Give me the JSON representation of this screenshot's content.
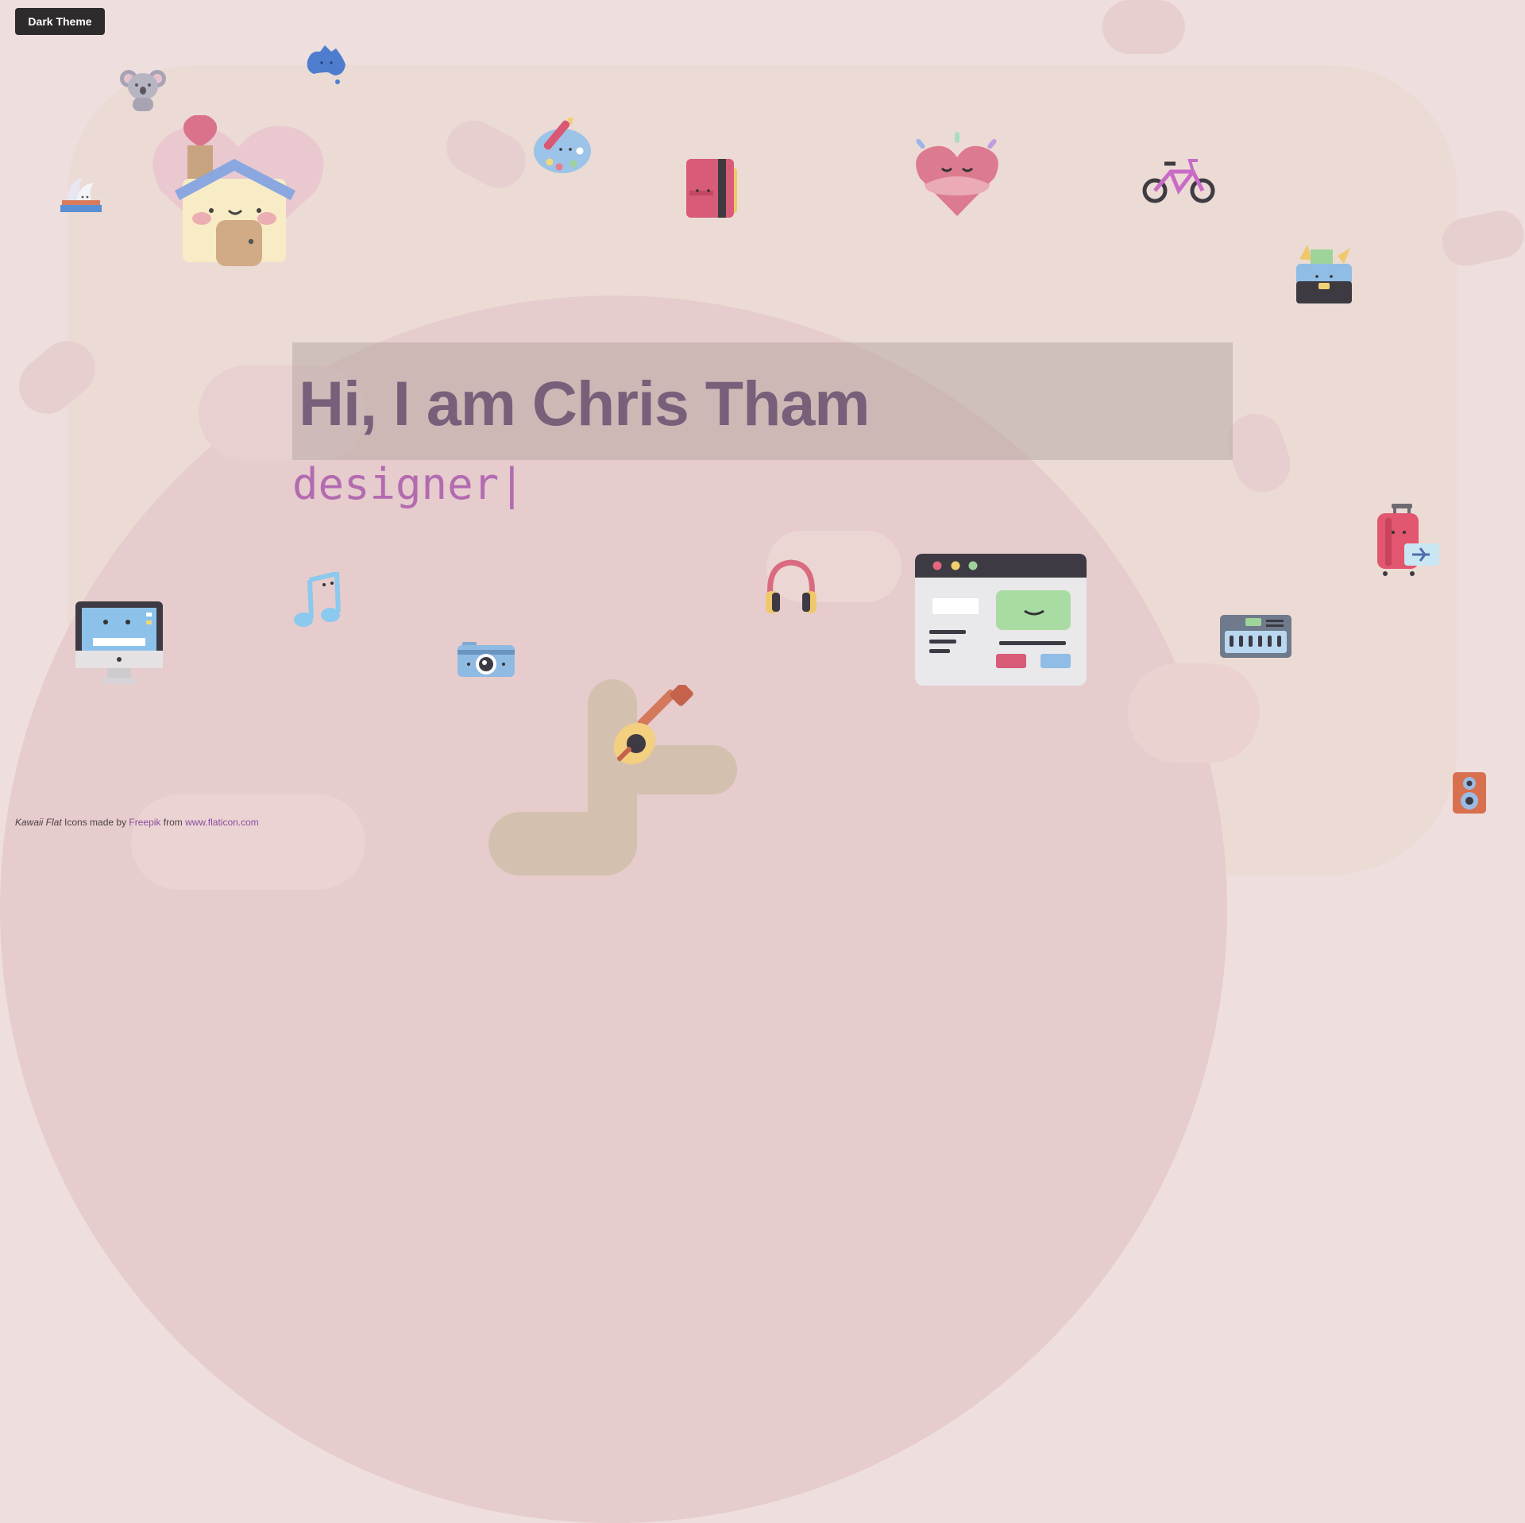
{
  "header": {
    "theme_button_label": "Dark Theme"
  },
  "hero": {
    "title": "Hi, I am Chris Tham",
    "role": "designer",
    "cursor": "|"
  },
  "credits": {
    "pack_name": "Kawaii Flat",
    "text_1": " Icons made by ",
    "author": "Freepik",
    "text_2": " from ",
    "site": "www.flaticon.com"
  },
  "icons": [
    "koala-icon",
    "australia-map-icon",
    "opera-house-icon",
    "home-heart-icon",
    "palette-icon",
    "sketchbook-icon",
    "hugging-heart-icon",
    "bicycle-icon",
    "briefcase-icon",
    "monitor-icon",
    "music-note-icon",
    "camera-icon",
    "headphones-icon",
    "browser-window-icon",
    "guitar-icon",
    "luggage-icon",
    "keyboard-icon",
    "speaker-icon"
  ],
  "colors": {
    "background": "#eedede",
    "title": "#78607a",
    "role": "#b26bb0",
    "button": "#2f2b2c"
  }
}
